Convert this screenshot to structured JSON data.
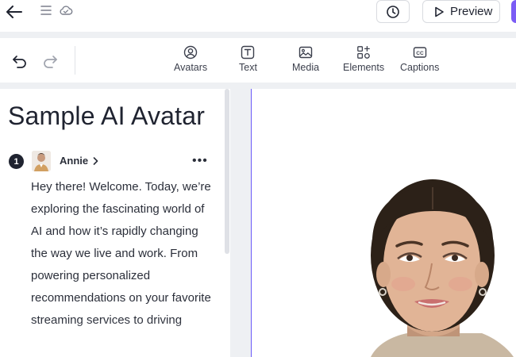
{
  "header": {
    "back_icon": "arrow-left-icon",
    "menu_icon": "menu-icon",
    "cloud_icon": "cloud-saved-icon",
    "history_icon": "clock-icon",
    "preview_label": "Preview",
    "preview_icon": "play-icon",
    "accent_color": "#7b5cf5"
  },
  "toolbar": {
    "undo_icon": "undo-icon",
    "redo_icon": "redo-icon",
    "tools": [
      {
        "label": "Avatars",
        "icon": "avatar-icon"
      },
      {
        "label": "Text",
        "icon": "text-icon"
      },
      {
        "label": "Media",
        "icon": "image-icon"
      },
      {
        "label": "Elements",
        "icon": "shapes-icon"
      },
      {
        "label": "Captions",
        "icon": "cc-icon"
      }
    ]
  },
  "script": {
    "title": "Sample AI Avatar",
    "scene_number": "1",
    "speaker_name": "Annie",
    "more_label": "•••",
    "text": "Hey there! Welcome. Today, we’re exploring the fascinating world of AI and how it’s rapidly changing the way we live and work. From powering personalized recommendations on your favorite streaming services to driving"
  },
  "canvas": {
    "guide_color": "#6a5af9",
    "avatar_image": "ai-avatar-woman"
  }
}
